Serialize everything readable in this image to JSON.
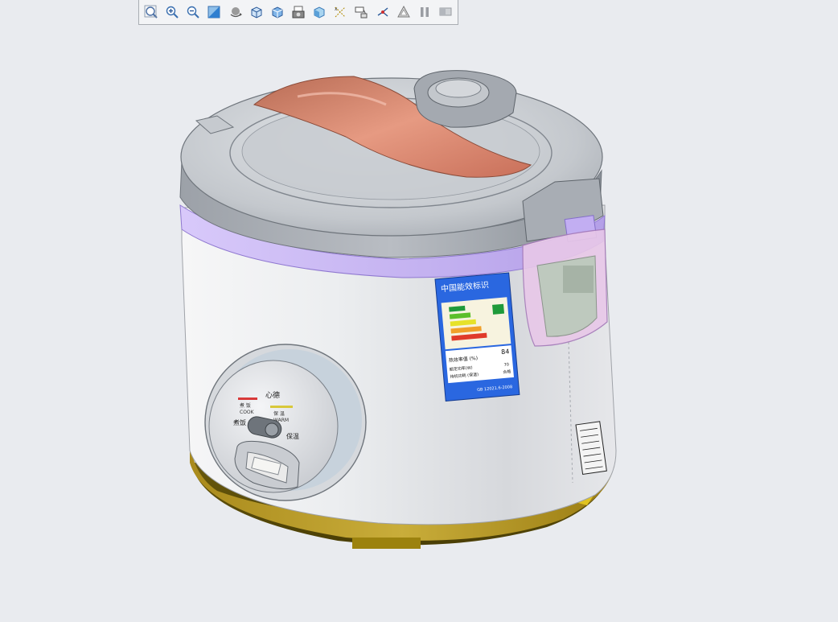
{
  "toolbar": {
    "buttons": [
      {
        "id": "zoom-fit",
        "icon": "zoom-fit-icon"
      },
      {
        "id": "zoom-in",
        "icon": "zoom-in-icon"
      },
      {
        "id": "zoom-out",
        "icon": "zoom-out-icon"
      },
      {
        "id": "repaint",
        "icon": "repaint-icon"
      },
      {
        "id": "spin",
        "icon": "spin-icon"
      },
      {
        "id": "view-orientation",
        "icon": "cube-icon"
      },
      {
        "id": "display-style",
        "icon": "display-style-icon"
      },
      {
        "id": "saved-views",
        "icon": "camera-view-icon"
      },
      {
        "id": "appearance",
        "icon": "appearance-icon"
      },
      {
        "id": "datum-display",
        "icon": "datum-display-icon"
      },
      {
        "id": "annotation-display",
        "icon": "annotation-icon"
      },
      {
        "id": "spin-center",
        "icon": "spin-center-icon"
      },
      {
        "id": "perspective",
        "icon": "perspective-icon"
      },
      {
        "id": "pause",
        "icon": "pause-icon"
      },
      {
        "id": "section",
        "icon": "section-icon"
      }
    ]
  },
  "model": {
    "name": "rice-cooker",
    "colors": {
      "lid": "#9fa5ad",
      "handle": "#d9826a",
      "body": "#e8e9ec",
      "trim": "#c7b6ef",
      "base": "#b89a28",
      "label_bg": "#2a67e0"
    },
    "panel": {
      "brand": "心德",
      "left_indicator": "煮 饭",
      "left_indicator_en": "COOK",
      "right_indicator": "保 温",
      "right_indicator_en": "WARM",
      "switch_left": "煮饭",
      "switch_right": "保温"
    },
    "energy_label": {
      "title": "中国能效标识",
      "value_label": "热效率值 (%)",
      "value": "84",
      "row2_label": "额定功率(W)",
      "row2_value": "70",
      "row3_label": "待机功耗 (保温)",
      "row3_value": "合格",
      "footer": "GB 12021.6-2008"
    }
  }
}
